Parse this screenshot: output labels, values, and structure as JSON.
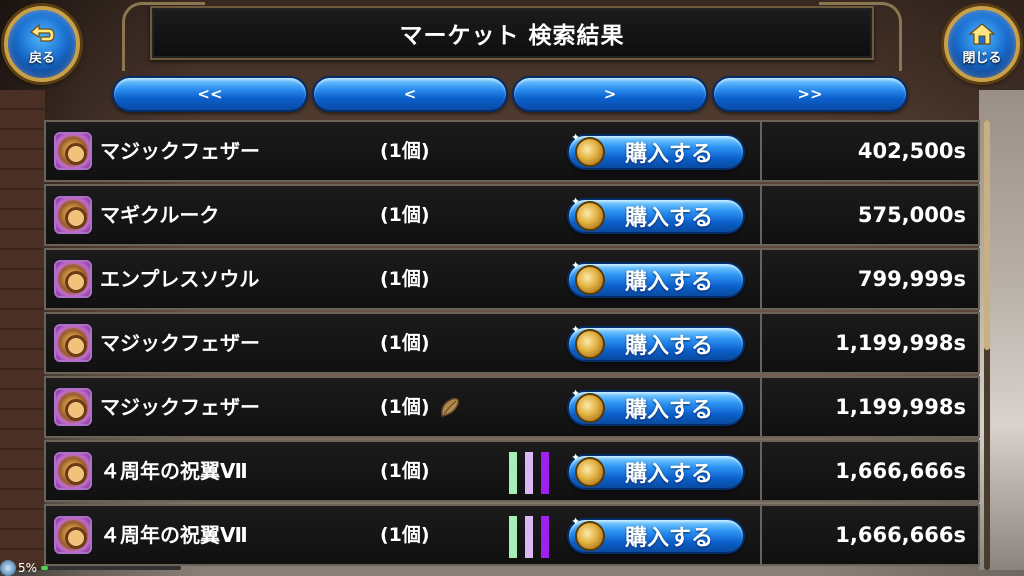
{
  "header": {
    "title": "マーケット 検索結果"
  },
  "nav": {
    "back_label": "戻る",
    "back_icon": "back-arrow-icon",
    "close_label": "閉じる",
    "close_icon": "home-icon"
  },
  "pager": {
    "first": "<<",
    "prev": "<",
    "next": ">",
    "last": ">>"
  },
  "buy_label": "購入する",
  "listings": [
    {
      "name": "マジックフェザー",
      "qty": "(1個)",
      "price": "402,500s",
      "rarity": false,
      "seed": false
    },
    {
      "name": "マギクルーク",
      "qty": "(1個)",
      "price": "575,000s",
      "rarity": false,
      "seed": false
    },
    {
      "name": "エンプレスソウル",
      "qty": "(1個)",
      "price": "799,999s",
      "rarity": false,
      "seed": false
    },
    {
      "name": "マジックフェザー",
      "qty": "(1個)",
      "price": "1,199,998s",
      "rarity": false,
      "seed": false
    },
    {
      "name": "マジックフェザー",
      "qty": "(1個)",
      "price": "1,199,998s",
      "rarity": false,
      "seed": true
    },
    {
      "name": "４周年の祝翼Ⅶ",
      "qty": "(1個)",
      "price": "1,666,666s",
      "rarity": true,
      "seed": false
    },
    {
      "name": "４周年の祝翼Ⅶ",
      "qty": "(1個)",
      "price": "1,666,666s",
      "rarity": true,
      "seed": false
    }
  ],
  "rarity_colors": [
    "#a6f0b8",
    "#d9b8f5",
    "#a020f0"
  ],
  "status": {
    "percent_text": "5%",
    "percent": 5
  },
  "colors": {
    "button_blue": "#1a6fd0",
    "frame_gold": "#c9a04a",
    "row_border": "#6a6458"
  }
}
